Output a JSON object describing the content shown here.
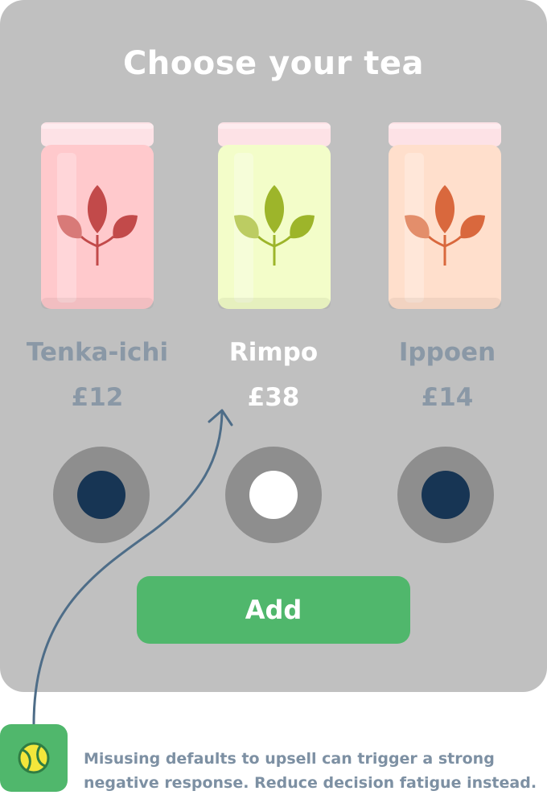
{
  "title": "Choose your tea",
  "teas": [
    {
      "name": "Tenka-ichi",
      "price": "£12",
      "selected": false,
      "colors": {
        "jar": "#ffc9cc",
        "lid": "#fde2e6",
        "leaf": "#c24a4a",
        "leaf_light": "#d87a78"
      }
    },
    {
      "name": "Rimpo",
      "price": "£38",
      "selected": true,
      "colors": {
        "jar": "#f3fdc9",
        "lid": "#fde2e6",
        "leaf": "#9db52a",
        "leaf_light": "#bccc62"
      }
    },
    {
      "name": "Ippoen",
      "price": "£14",
      "selected": false,
      "colors": {
        "jar": "#ffdfcc",
        "lid": "#fde2e6",
        "leaf": "#d9683d",
        "leaf_light": "#e38e6b"
      }
    }
  ],
  "add_button": {
    "label": "Add"
  },
  "tip": {
    "icon": "tennis-ball-icon",
    "line1": "Misusing defaults to upsell can trigger a strong",
    "line2": "negative response. Reduce decision fatigue instead."
  },
  "colors": {
    "card_bg": "#c0c0c0",
    "accent_green": "#50b76c",
    "radio_ring": "#8e8e8e",
    "radio_dot": "#173554",
    "muted_text": "#8a98a6",
    "arrow": "#4e6d88"
  }
}
